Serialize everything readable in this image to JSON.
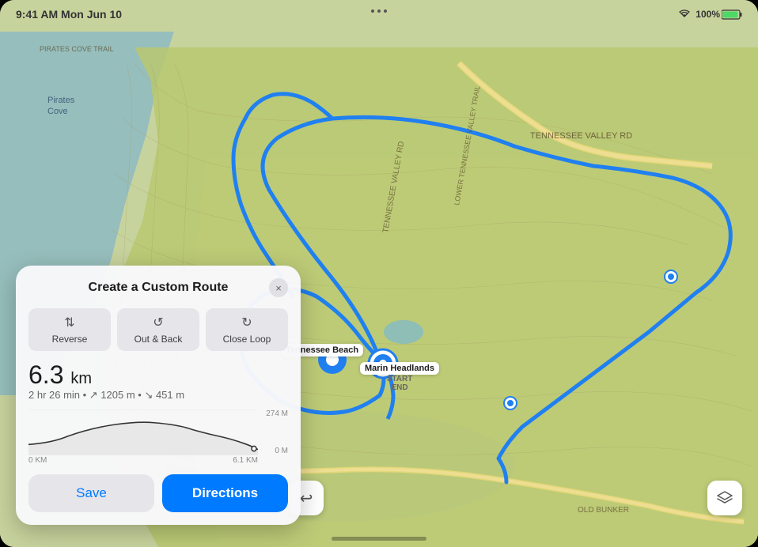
{
  "statusBar": {
    "time": "9:41 AM Mon Jun 10",
    "wifi": "WiFi",
    "battery": "100%"
  },
  "panel": {
    "title": "Create a Custom Route",
    "closeLabel": "×",
    "routeTypes": [
      {
        "icon": "⇅",
        "label": "Reverse"
      },
      {
        "icon": "↺",
        "label": "Out & Back"
      },
      {
        "icon": "↻",
        "label": "Close Loop"
      }
    ],
    "distance": "6.3",
    "distanceUnit": "km",
    "statsDetail": "2 hr 26 min • ↗ 1205 m • ↘ 451 m",
    "chartYLabels": [
      "274 M",
      "0 M"
    ],
    "chartXLabels": [
      "0 KM",
      "6.1 KM"
    ],
    "saveLabel": "Save",
    "directionsLabel": "Directions"
  },
  "mapPins": [
    {
      "label": "Tennessee Beach"
    },
    {
      "label": "Marin Headlands"
    },
    {
      "label": "START"
    },
    {
      "label": "END"
    }
  ],
  "mapControls": {
    "undoIcon": "↩",
    "layersIcon": "⊞"
  }
}
